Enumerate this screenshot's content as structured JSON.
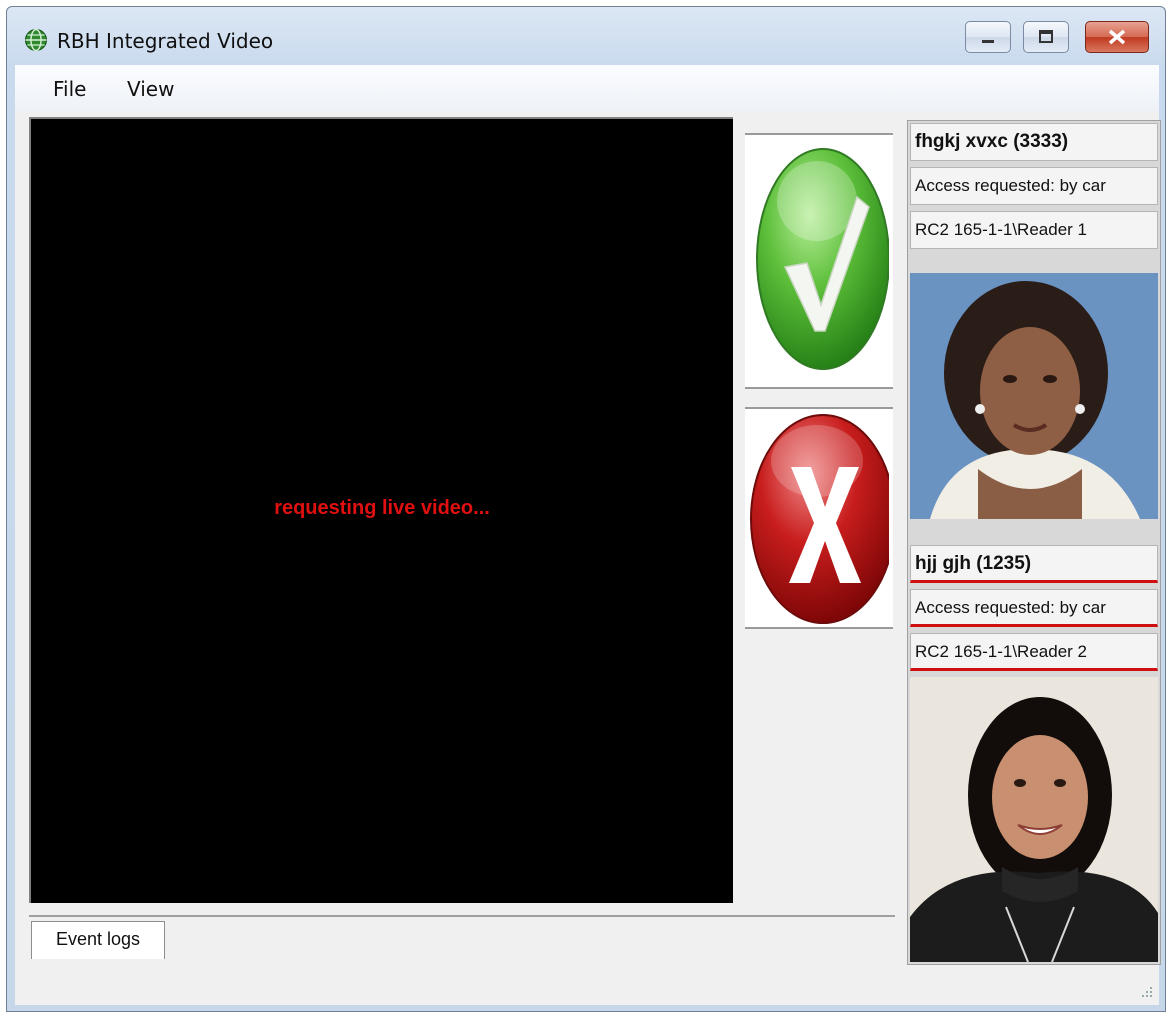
{
  "window": {
    "title": "RBH Integrated Video"
  },
  "menu": {
    "items": [
      "File",
      "View"
    ]
  },
  "video": {
    "status_message": "requesting live video..."
  },
  "actions": {
    "accept_icon": "checkmark-icon",
    "deny_icon": "x-icon"
  },
  "tabs": [
    {
      "label": "Event logs"
    }
  ],
  "events": [
    {
      "name": "fhgkj xvxc (3333)",
      "description": "Access requested: by car",
      "location": "RC2 165-1-1\\Reader 1"
    },
    {
      "name": "hjj gjh (1235)",
      "description": "Access requested: by car",
      "location": "RC2 165-1-1\\Reader 2"
    }
  ],
  "colors": {
    "video_message": "#e01010",
    "accept": "#3faa2c",
    "deny": "#c01515",
    "highlight": "#d01010"
  }
}
